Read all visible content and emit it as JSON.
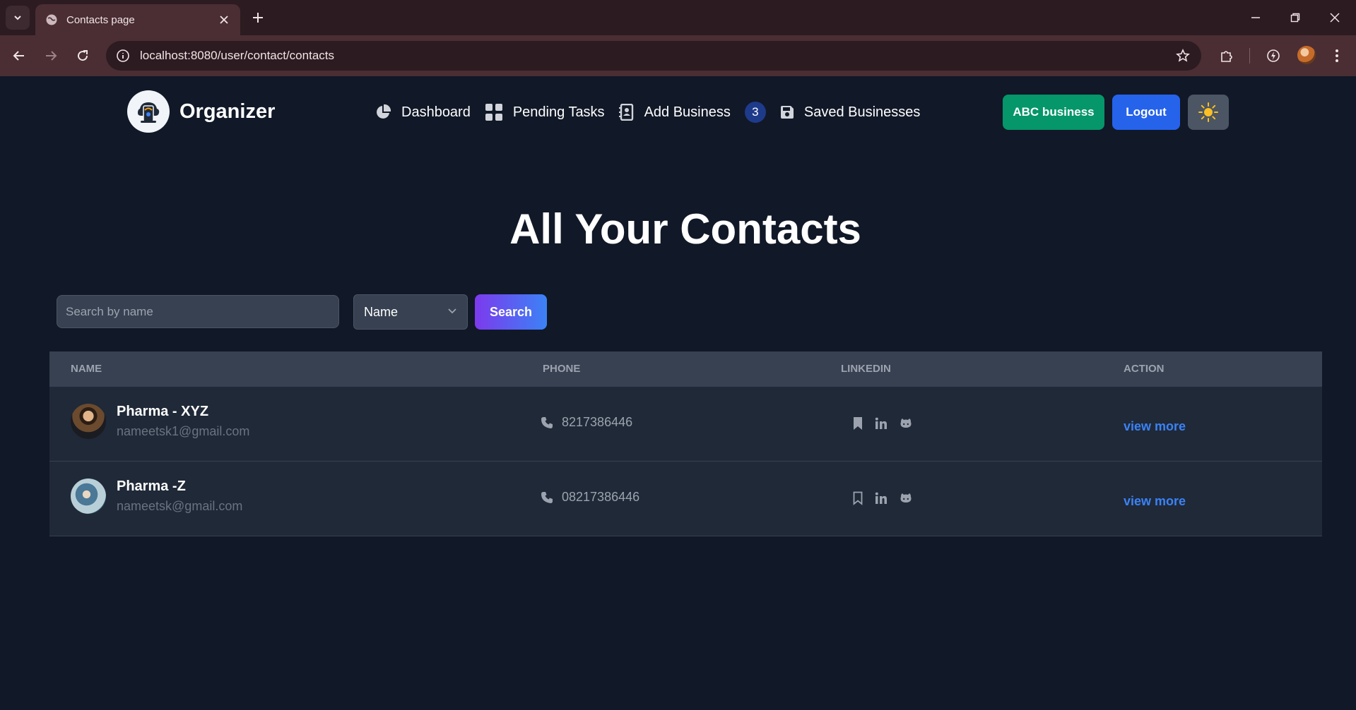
{
  "browser": {
    "tab_title": "Contacts page",
    "url": "localhost:8080/user/contact/contacts"
  },
  "navbar": {
    "brand": "Organizer",
    "items": [
      {
        "label": "Dashboard",
        "icon": "pie-chart-icon"
      },
      {
        "label": "Pending Tasks",
        "icon": "grid-icon"
      },
      {
        "label": "Add Business",
        "icon": "address-book-icon"
      },
      {
        "label": "Saved Businesses",
        "icon": "floppy-disk-icon"
      }
    ],
    "badge_count": "3",
    "user_button": "ABC business",
    "logout_button": "Logout",
    "theme_icon": "sun-icon"
  },
  "page": {
    "title": "All Your Contacts"
  },
  "search": {
    "placeholder": "Search by name",
    "field_value": "Name",
    "button_label": "Search"
  },
  "table": {
    "headers": [
      "NAME",
      "PHONE",
      "LINKEDIN",
      "ACTION"
    ],
    "rows": [
      {
        "name": "Pharma - XYZ",
        "email": "nameetsk1@gmail.com",
        "phone": "8217386446",
        "favorite": true,
        "action": "view more"
      },
      {
        "name": "Pharma -Z",
        "email": "nameetsk@gmail.com",
        "phone": "08217386446",
        "favorite": false,
        "action": "view more"
      }
    ]
  },
  "colors": {
    "background": "#111827",
    "row": "#1f2937",
    "header": "#374151",
    "business_button": "#059669",
    "logout_button": "#2563eb",
    "link": "#3b82f6"
  }
}
